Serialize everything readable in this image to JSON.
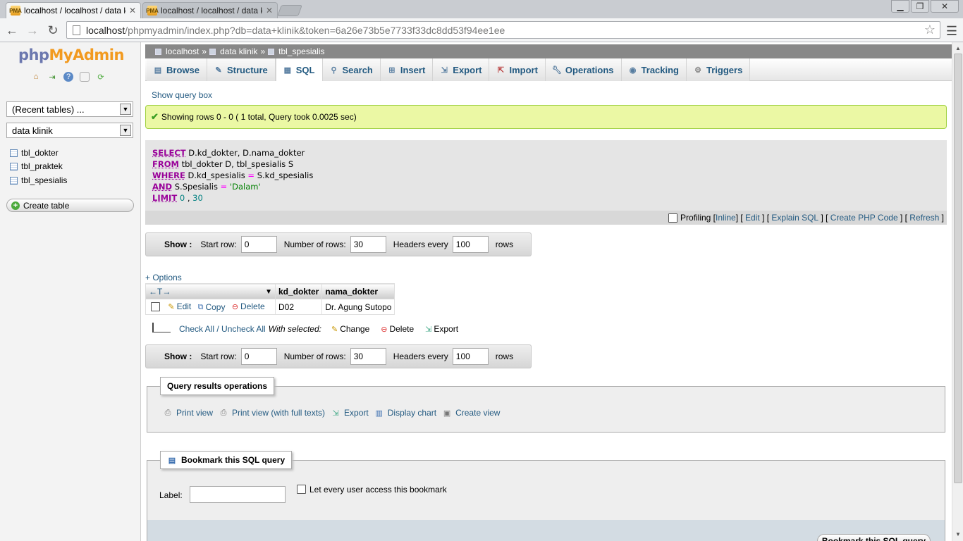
{
  "browser": {
    "tabs": [
      {
        "title": "localhost / localhost / data klir",
        "active": true
      },
      {
        "title": "localhost / localhost / data klir",
        "active": false
      }
    ],
    "favicon_text": "PMA",
    "url_host": "localhost",
    "url_path": "/phpmyadmin/index.php?db=data+klinik&token=6a26e73b5e7733f33dc8dd53f94ee1ee"
  },
  "sidebar": {
    "logo_php": "php",
    "logo_myadmin": "MyAdmin",
    "recent_tables": "(Recent tables) ...",
    "database": "data klinik",
    "tables": [
      "tbl_dokter",
      "tbl_praktek",
      "tbl_spesialis"
    ],
    "create_table": "Create table"
  },
  "breadcrumb": {
    "server": "localhost",
    "database": "data klinik",
    "table": "tbl_spesialis",
    "separator": "»"
  },
  "tabs": [
    "Browse",
    "Structure",
    "SQL",
    "Search",
    "Insert",
    "Export",
    "Import",
    "Operations",
    "Tracking",
    "Triggers"
  ],
  "show_query_box": "Show query box",
  "success_message": "Showing rows 0 - 0 ( 1 total, Query took 0.0025 sec)",
  "sql": {
    "line1": {
      "kw": "SELECT",
      "rest": " D.kd_dokter, D.nama_dokter"
    },
    "line2": {
      "kw": "FROM",
      "rest": " tbl_dokter D, tbl_spesialis S"
    },
    "line3": {
      "kw": "WHERE",
      "a": " D.kd_spesialis ",
      "op": "=",
      "b": " S.kd_spesialis"
    },
    "line4": {
      "kw": "AND",
      "a": " S.Spesialis ",
      "op": "=",
      "str": " 'Dalam'"
    },
    "line5": {
      "kw": "LIMIT",
      "n1": " 0",
      "sep": " , ",
      "n2": "30"
    }
  },
  "sql_actions": {
    "profiling": "Profiling",
    "inline": "Inline",
    "edit": "Edit",
    "explain": "Explain SQL",
    "php": "Create PHP Code",
    "refresh": "Refresh"
  },
  "show_bar": {
    "show": "Show :",
    "start_row_label": "Start row:",
    "start_row": "0",
    "num_rows_label": "Number of rows:",
    "num_rows": "30",
    "headers_label": "Headers every",
    "headers": "100",
    "rows_label": "rows"
  },
  "options": "+ Options",
  "results": {
    "sort_arrows": "←T→",
    "columns": [
      "kd_dokter",
      "nama_dokter"
    ],
    "row": {
      "edit": "Edit",
      "copy": "Copy",
      "delete": "Delete",
      "kd_dokter": "D02",
      "nama_dokter": "Dr. Agung Sutopo"
    }
  },
  "with_selected": {
    "check_all": "Check All / Uncheck All",
    "label": "With selected:",
    "change": "Change",
    "delete": "Delete",
    "export": "Export"
  },
  "query_ops": {
    "title": "Query results operations",
    "print": "Print view",
    "print_full": "Print view (with full texts)",
    "export": "Export",
    "chart": "Display chart",
    "view": "Create view"
  },
  "bookmark": {
    "title": "Bookmark this SQL query",
    "label": "Label:",
    "every_user": "Let every user access this bookmark",
    "button": "Bookmark this SQL query"
  }
}
